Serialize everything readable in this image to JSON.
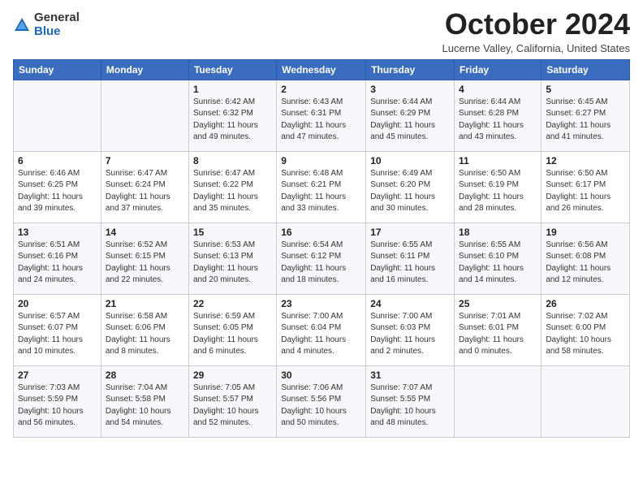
{
  "header": {
    "logo_general": "General",
    "logo_blue": "Blue",
    "month_title": "October 2024",
    "location": "Lucerne Valley, California, United States"
  },
  "weekdays": [
    "Sunday",
    "Monday",
    "Tuesday",
    "Wednesday",
    "Thursday",
    "Friday",
    "Saturday"
  ],
  "weeks": [
    [
      {
        "day": "",
        "detail": ""
      },
      {
        "day": "",
        "detail": ""
      },
      {
        "day": "1",
        "detail": "Sunrise: 6:42 AM\nSunset: 6:32 PM\nDaylight: 11 hours and 49 minutes."
      },
      {
        "day": "2",
        "detail": "Sunrise: 6:43 AM\nSunset: 6:31 PM\nDaylight: 11 hours and 47 minutes."
      },
      {
        "day": "3",
        "detail": "Sunrise: 6:44 AM\nSunset: 6:29 PM\nDaylight: 11 hours and 45 minutes."
      },
      {
        "day": "4",
        "detail": "Sunrise: 6:44 AM\nSunset: 6:28 PM\nDaylight: 11 hours and 43 minutes."
      },
      {
        "day": "5",
        "detail": "Sunrise: 6:45 AM\nSunset: 6:27 PM\nDaylight: 11 hours and 41 minutes."
      }
    ],
    [
      {
        "day": "6",
        "detail": "Sunrise: 6:46 AM\nSunset: 6:25 PM\nDaylight: 11 hours and 39 minutes."
      },
      {
        "day": "7",
        "detail": "Sunrise: 6:47 AM\nSunset: 6:24 PM\nDaylight: 11 hours and 37 minutes."
      },
      {
        "day": "8",
        "detail": "Sunrise: 6:47 AM\nSunset: 6:22 PM\nDaylight: 11 hours and 35 minutes."
      },
      {
        "day": "9",
        "detail": "Sunrise: 6:48 AM\nSunset: 6:21 PM\nDaylight: 11 hours and 33 minutes."
      },
      {
        "day": "10",
        "detail": "Sunrise: 6:49 AM\nSunset: 6:20 PM\nDaylight: 11 hours and 30 minutes."
      },
      {
        "day": "11",
        "detail": "Sunrise: 6:50 AM\nSunset: 6:19 PM\nDaylight: 11 hours and 28 minutes."
      },
      {
        "day": "12",
        "detail": "Sunrise: 6:50 AM\nSunset: 6:17 PM\nDaylight: 11 hours and 26 minutes."
      }
    ],
    [
      {
        "day": "13",
        "detail": "Sunrise: 6:51 AM\nSunset: 6:16 PM\nDaylight: 11 hours and 24 minutes."
      },
      {
        "day": "14",
        "detail": "Sunrise: 6:52 AM\nSunset: 6:15 PM\nDaylight: 11 hours and 22 minutes."
      },
      {
        "day": "15",
        "detail": "Sunrise: 6:53 AM\nSunset: 6:13 PM\nDaylight: 11 hours and 20 minutes."
      },
      {
        "day": "16",
        "detail": "Sunrise: 6:54 AM\nSunset: 6:12 PM\nDaylight: 11 hours and 18 minutes."
      },
      {
        "day": "17",
        "detail": "Sunrise: 6:55 AM\nSunset: 6:11 PM\nDaylight: 11 hours and 16 minutes."
      },
      {
        "day": "18",
        "detail": "Sunrise: 6:55 AM\nSunset: 6:10 PM\nDaylight: 11 hours and 14 minutes."
      },
      {
        "day": "19",
        "detail": "Sunrise: 6:56 AM\nSunset: 6:08 PM\nDaylight: 11 hours and 12 minutes."
      }
    ],
    [
      {
        "day": "20",
        "detail": "Sunrise: 6:57 AM\nSunset: 6:07 PM\nDaylight: 11 hours and 10 minutes."
      },
      {
        "day": "21",
        "detail": "Sunrise: 6:58 AM\nSunset: 6:06 PM\nDaylight: 11 hours and 8 minutes."
      },
      {
        "day": "22",
        "detail": "Sunrise: 6:59 AM\nSunset: 6:05 PM\nDaylight: 11 hours and 6 minutes."
      },
      {
        "day": "23",
        "detail": "Sunrise: 7:00 AM\nSunset: 6:04 PM\nDaylight: 11 hours and 4 minutes."
      },
      {
        "day": "24",
        "detail": "Sunrise: 7:00 AM\nSunset: 6:03 PM\nDaylight: 11 hours and 2 minutes."
      },
      {
        "day": "25",
        "detail": "Sunrise: 7:01 AM\nSunset: 6:01 PM\nDaylight: 11 hours and 0 minutes."
      },
      {
        "day": "26",
        "detail": "Sunrise: 7:02 AM\nSunset: 6:00 PM\nDaylight: 10 hours and 58 minutes."
      }
    ],
    [
      {
        "day": "27",
        "detail": "Sunrise: 7:03 AM\nSunset: 5:59 PM\nDaylight: 10 hours and 56 minutes."
      },
      {
        "day": "28",
        "detail": "Sunrise: 7:04 AM\nSunset: 5:58 PM\nDaylight: 10 hours and 54 minutes."
      },
      {
        "day": "29",
        "detail": "Sunrise: 7:05 AM\nSunset: 5:57 PM\nDaylight: 10 hours and 52 minutes."
      },
      {
        "day": "30",
        "detail": "Sunrise: 7:06 AM\nSunset: 5:56 PM\nDaylight: 10 hours and 50 minutes."
      },
      {
        "day": "31",
        "detail": "Sunrise: 7:07 AM\nSunset: 5:55 PM\nDaylight: 10 hours and 48 minutes."
      },
      {
        "day": "",
        "detail": ""
      },
      {
        "day": "",
        "detail": ""
      }
    ]
  ]
}
